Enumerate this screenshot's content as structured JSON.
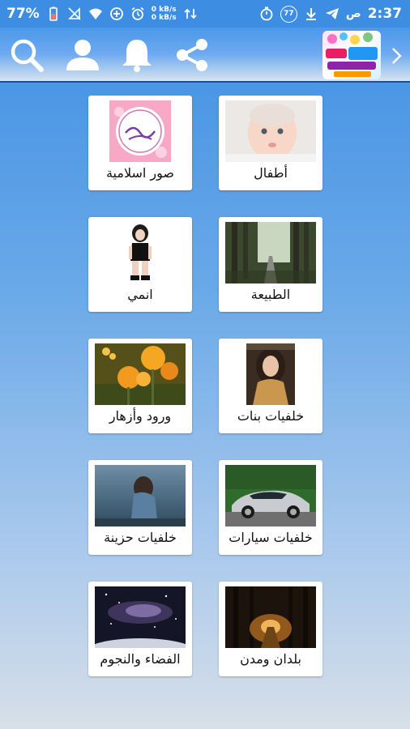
{
  "status_bar": {
    "battery": "77%",
    "speed_up": "0 kB/s",
    "speed_down": "0 kB/s",
    "badge": "77",
    "time": "2:37",
    "ampm": "ص"
  },
  "toolbar": {
    "icons": [
      "search-icon",
      "user-icon",
      "bell-icon",
      "share-icon",
      "chevron-right-icon"
    ]
  },
  "categories": [
    {
      "label": "أطفال"
    },
    {
      "label": "صور اسلامية"
    },
    {
      "label": "الطبيعة"
    },
    {
      "label": "انمي"
    },
    {
      "label": "خلفيات بنات"
    },
    {
      "label": "ورود وأزهار"
    },
    {
      "label": "خلفيات سيارات"
    },
    {
      "label": "خلفيات حزينة"
    },
    {
      "label": "بلدان ومدن"
    },
    {
      "label": "الفضاء والنجوم"
    }
  ],
  "colors": {
    "status_bar": "#3d8de2",
    "card_bg": "#ffffff"
  }
}
